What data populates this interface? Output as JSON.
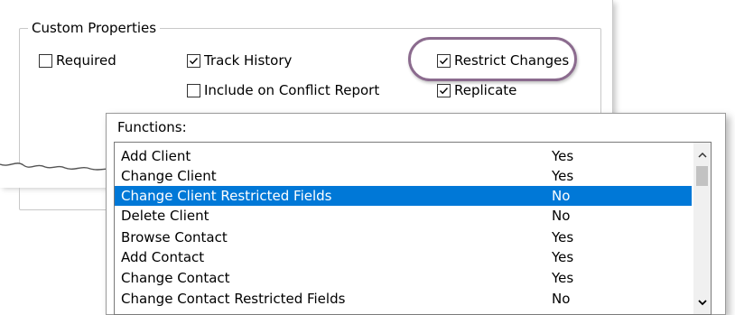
{
  "custom_properties": {
    "title": "Custom Properties",
    "checkboxes": [
      {
        "label": "Required",
        "checked": false
      },
      {
        "label": "Track History",
        "checked": true
      },
      {
        "label": "Include on Conflict Report",
        "checked": false
      },
      {
        "label": "Restrict Changes",
        "checked": true,
        "highlighted": true
      },
      {
        "label": "Replicate",
        "checked": true
      }
    ]
  },
  "functions": {
    "label": "Functions:",
    "rows": [
      {
        "name": "Add Client",
        "value": "Yes",
        "selected": false
      },
      {
        "name": "Change Client",
        "value": "Yes",
        "selected": false
      },
      {
        "name": "Change Client Restricted Fields",
        "value": "No",
        "selected": true
      },
      {
        "name": "Delete Client",
        "value": "No",
        "selected": false
      },
      {
        "name": "Browse Contact",
        "value": "Yes",
        "selected": false
      },
      {
        "name": "Add Contact",
        "value": "Yes",
        "selected": false
      },
      {
        "name": "Change Contact",
        "value": "Yes",
        "selected": false
      },
      {
        "name": "Change Contact Restricted Fields",
        "value": "No",
        "selected": false
      }
    ],
    "scroll_up_icon": "chevron-up-icon",
    "scroll_down_icon": "chevron-down-icon"
  },
  "colors": {
    "selection": "#0078d7",
    "highlight_oval": "#8b6b8e"
  }
}
